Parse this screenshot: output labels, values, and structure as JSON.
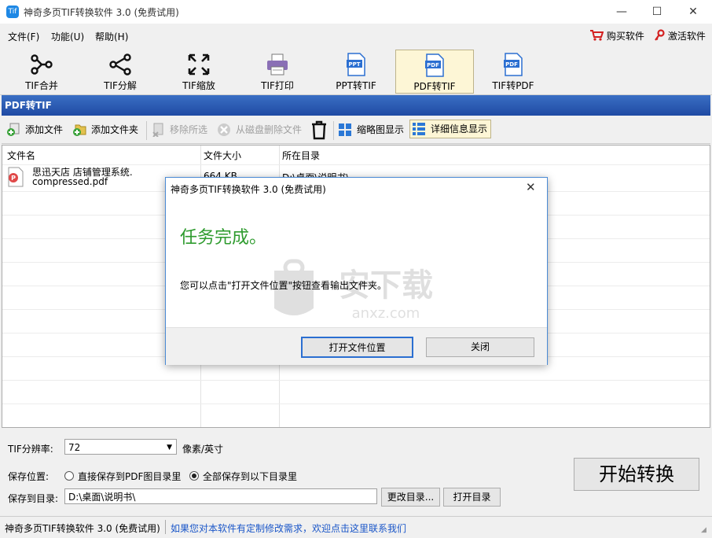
{
  "window": {
    "title": "神奇多页TIF转换软件 3.0 (免费试用)",
    "icon_text": "Tif",
    "controls": [
      "—",
      "☐",
      "✕"
    ]
  },
  "menu": {
    "items": [
      "文件(F)",
      "功能(U)",
      "帮助(H)"
    ],
    "buy": "购买软件",
    "activate": "激活软件"
  },
  "toolbar": {
    "items": [
      {
        "label": "TIF合并",
        "icon": "merge-icon"
      },
      {
        "label": "TIF分解",
        "icon": "split-icon"
      },
      {
        "label": "TIF缩放",
        "icon": "resize-icon"
      },
      {
        "label": "TIF打印",
        "icon": "printer-icon"
      },
      {
        "label": "PPT转TIF",
        "icon": "ppt-file-icon",
        "badge": "PPT"
      },
      {
        "label": "PDF转TIF",
        "icon": "pdf-file-icon",
        "badge": "PDF",
        "active": true
      },
      {
        "label": "TIF转PDF",
        "icon": "pdf-file-icon",
        "badge": "PDF"
      }
    ]
  },
  "section_title": "PDF转TIF",
  "actions": {
    "add_file": "添加文件",
    "add_folder": "添加文件夹",
    "remove_selected": "移除所选",
    "delete_from_disk": "从磁盘删除文件",
    "thumbnail_view": "缩略图显示",
    "detail_view": "详细信息显示"
  },
  "table": {
    "columns": [
      "文件名",
      "文件大小",
      "所在目录"
    ],
    "rows": [
      {
        "name_line1": "思迅天店 店铺管理系统.",
        "name_line2": "compressed.pdf",
        "size": "664 KB",
        "dir": "D:\\桌面\\说明书\\"
      }
    ]
  },
  "settings": {
    "resolution_label": "TIF分辨率:",
    "resolution_value": "72",
    "resolution_unit": "像素/英寸",
    "save_location_label": "保存位置:",
    "radio_pdf_dir": "直接保存到PDF图目录里",
    "radio_all_dir": "全部保存到以下目录里",
    "save_dir_label": "保存到目录:",
    "save_dir_value": "D:\\桌面\\说明书\\",
    "change_dir_button": "更改目录...",
    "open_dir_button": "打开目录",
    "start_button": "开始转换"
  },
  "status": {
    "left": "神奇多页TIF转换软件 3.0 (免费试用)",
    "link": "如果您对本软件有定制修改需求，欢迎点击这里联系我们"
  },
  "dialog": {
    "title": "神奇多页TIF转换软件 3.0 (免费试用)",
    "heading": "任务完成。",
    "message": "您可以点击\"打开文件位置\"按钮查看输出文件夹。",
    "open_button": "打开文件位置",
    "close_button": "关闭",
    "watermark_text": "安下载",
    "watermark_sub": "anxz.com"
  },
  "colors": {
    "accent_blue": "#1f4aa3",
    "success_green": "#2e9b2e",
    "link_blue": "#1a56c8",
    "active_bg": "#fdf6d6"
  }
}
